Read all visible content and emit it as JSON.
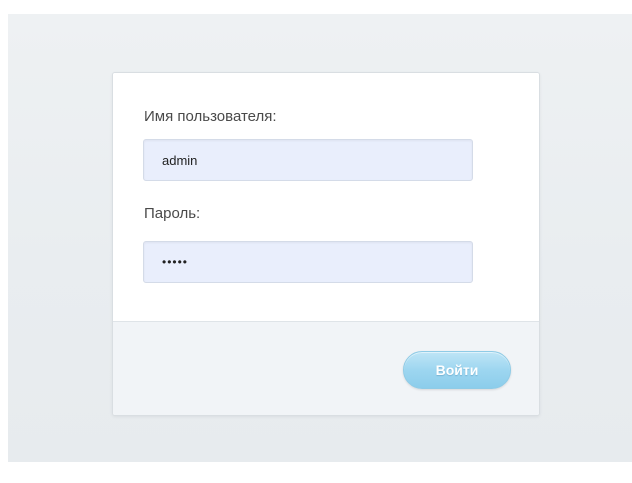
{
  "login_form": {
    "username": {
      "label": "Имя пользователя:",
      "value": "admin"
    },
    "password": {
      "label": "Пароль:",
      "value": "•••••"
    },
    "submit_label": "Войти"
  },
  "colors": {
    "input_background": "#e9eefc",
    "button_accent": "#9dd6f0",
    "footer_background": "#f1f4f7",
    "page_background": "#eef1f3"
  }
}
